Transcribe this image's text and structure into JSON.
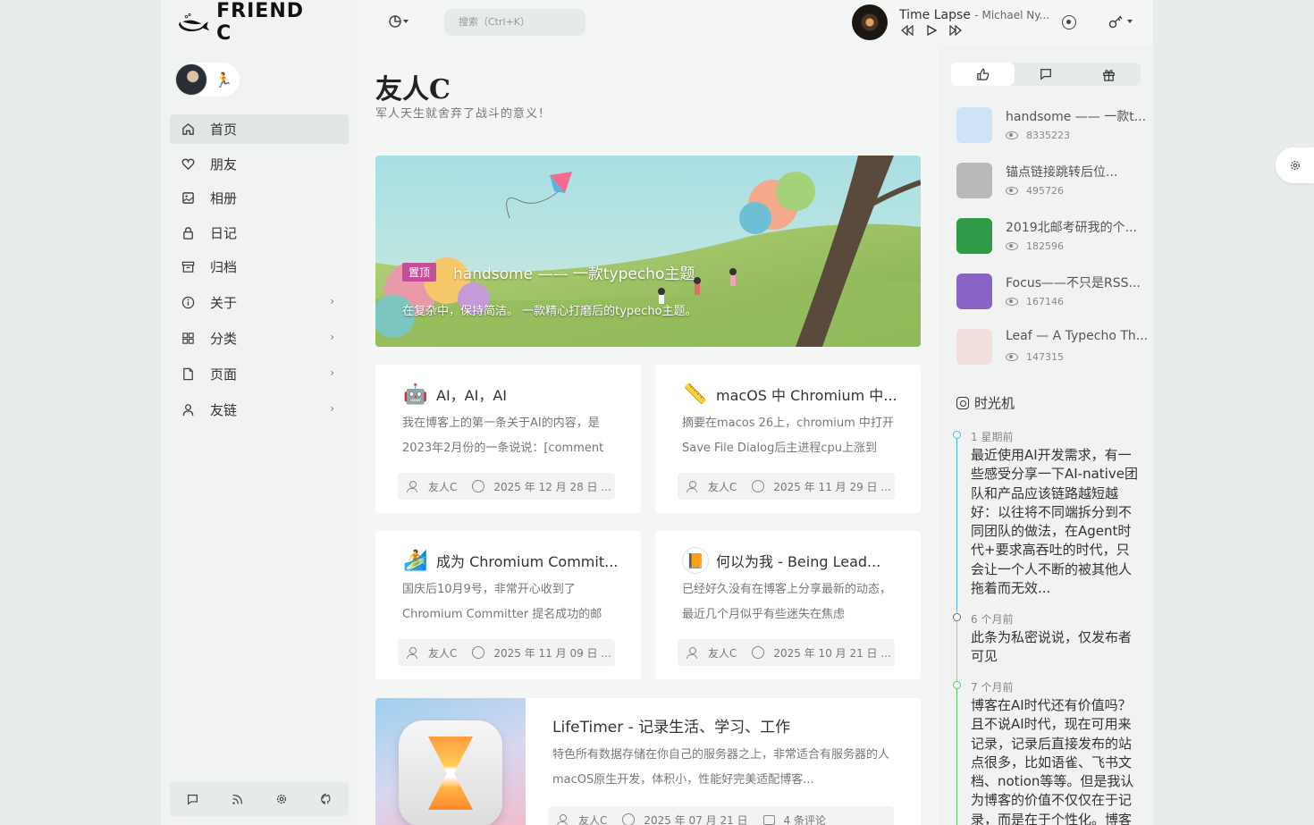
{
  "brand": {
    "logo_text": "FRIEND C"
  },
  "profile": {
    "status_emoji": "🏃"
  },
  "nav": {
    "items": [
      {
        "label": "首页"
      },
      {
        "label": "朋友"
      },
      {
        "label": "相册"
      },
      {
        "label": "日记"
      },
      {
        "label": "归档"
      },
      {
        "label": "关于"
      },
      {
        "label": "分类"
      },
      {
        "label": "页面"
      },
      {
        "label": "友链"
      }
    ]
  },
  "header": {
    "search_placeholder": "搜索（Ctrl+K）",
    "music": {
      "title": "Time Lapse",
      "artist": "- Michael Ny..."
    }
  },
  "page": {
    "title": "友人C",
    "subtitle": "军人天生就舍弃了战斗的意义！"
  },
  "hero": {
    "badge": "置顶",
    "title": "handsome —— 一款typecho主题",
    "desc": "在复杂中，保持简洁。 一款精心打磨后的typecho主题。"
  },
  "posts": [
    {
      "emoji": "🤖",
      "title": "AI，AI，AI",
      "desc": "我在博客上的第一条关于AI的内容，是2023年2月份的一条说说：[comment",
      "author": "友人C",
      "date": "2025 年 12 月 28 日 ..."
    },
    {
      "emoji": "📏",
      "title": "macOS 中 Chromium 中...",
      "desc": "摘要在macos 26上，chromium 中打开 Save File Dialog后主进程cpu上涨到",
      "author": "友人C",
      "date": "2025 年 11 月 29 日 ..."
    },
    {
      "emoji": "🏄",
      "title": "成为 Chromium Commit...",
      "desc": "国庆后10月9号，非常开心收到了 Chromium Committer 提名成功的邮",
      "author": "友人C",
      "date": "2025 年 11 月 09 日 ..."
    },
    {
      "emoji": "📙",
      "title": "何以为我 - Being Lead...",
      "desc": "已经好久没有在博客上分享最新的动态，最近几个月似乎有些迷失在焦虑",
      "author": "友人C",
      "date": "2025 年 10 月 21 日 ..."
    }
  ],
  "wide_post": {
    "title": "LifeTimer - 记录生活、学习、工作",
    "desc": "特色所有数据存储在你自己的服务器之上，非常适合有服务器的人macOS原生开发，体积小，性能好完美适配博客...",
    "author": "友人C",
    "date": "2025 年 07 月 21 日",
    "comments": "4 条评论"
  },
  "hot_posts": [
    {
      "title": "handsome —— 一款t...",
      "views": "8335223",
      "thumb_color": "#cfe3f7"
    },
    {
      "title": "锚点链接跳转后位...",
      "views": "495726",
      "thumb_color": "#b9b9b9"
    },
    {
      "title": "2019北邮考研我的个...",
      "views": "182596",
      "thumb_color": "#2f9a47"
    },
    {
      "title": "Focus——不只是RSS...",
      "views": "167146",
      "thumb_color": "#8a63c7"
    },
    {
      "title": "Leaf — A Typecho Th...",
      "views": "147315",
      "thumb_color": "#f3dede"
    }
  ],
  "timemachine": {
    "title": "时光机",
    "items": [
      {
        "time": "1 星期前",
        "text": "最近使用AI开发需求，有一些感受分享一下AI-native团队和产品应该链路越短越好：以往将不同端拆分到不同团队的做法，在Agent时代+要求高吞吐的时代，只会让一个人不断的被其他人拖着而无效...",
        "color": "#4fb3d9"
      },
      {
        "time": "6 个月前",
        "text": "此条为私密说说，仅发布者可见",
        "color": "#666666"
      },
      {
        "time": "7 个月前",
        "text": "博客在AI时代还有价值吗？且不说AI时代，现在可用来记录，记录后直接发布的站点很多，比如语雀、飞书文档、notion等等。但是我认为博客的价值不仅仅在于记录，而是在于个性化。博客",
        "color": "#5cc26e"
      }
    ]
  },
  "colors": {
    "badge": "#c24f98",
    "active_nav": "#e1e6e3",
    "timeline_blue": "#4fb3d9",
    "timeline_green": "#5cc26e"
  }
}
